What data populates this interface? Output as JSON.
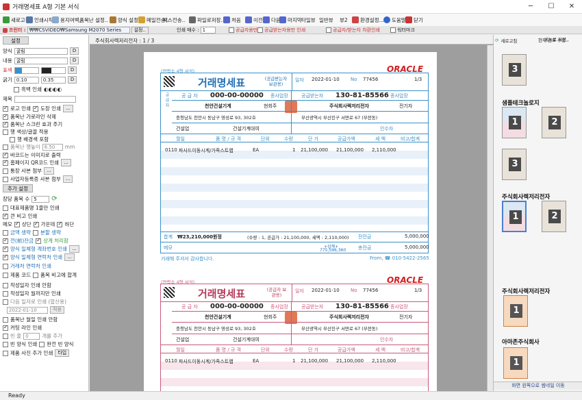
{
  "window": {
    "title": "거래명세표   A형 기본 서식"
  },
  "toolbar": {
    "items": [
      "새로고침",
      "인쇄시작",
      "용지여백,",
      "품목난 설정..",
      "양식 설정...",
      "메일전송..",
      "팩스전송..",
      "파일로저장..",
      "처음",
      "이전",
      "다음",
      "마지막",
      "타일뷰",
      "일반뷰",
      "뷰2",
      "환경설정...",
      "도움말",
      "닫기"
    ]
  },
  "toolbar2": {
    "printer_label": "프린터 :",
    "printer_value": "₩₩CSVIDEO₩Samsung M2070 Series",
    "printer_setup": "설정..",
    "copies_label": "인쇄 매수 :",
    "copies_value": "1",
    "opt1": "공급자용만",
    "opt2": "공급받는자용만 인쇄",
    "opt3": "공급자/받는자 차환인쇄",
    "opt4": "워터마크"
  },
  "left": {
    "tab": "설정",
    "font_label": "양식",
    "font_value": "굴림",
    "content_label": "내용",
    "content_value": "굴림",
    "color_label": "표색",
    "border_label": "굵기",
    "border_val1": "0.10",
    "border_val2": "0.35",
    "bw_print": "흑백 인쇄",
    "title_label": "제목",
    "logo_print": "로고 인쇄",
    "stamp_print": "도장 인쇄",
    "item_grid": "품목난 가로라인 삭제",
    "item_scroll": "품목난 스크린 효과 주기",
    "row_color": "행 색상/글꼴 적용",
    "row_bg": "행 배경색 포함",
    "item_height": "품목난 행높이",
    "item_height_val": "6.50",
    "item_height_unit": "mm",
    "barcode": "바코드는 이미지로 출력",
    "homepage_qr": "홈페이지 QR코드 인쇄",
    "bank_copy": "통장 사본 첨부",
    "biz_copy": "사업자등록증 사본 첨부",
    "tab2": "추가 설정",
    "item_count_label": "장당 품목 수",
    "item_count": "5",
    "max_items": "대표제품명 1줄만 인쇄",
    "big_note": "큰 비고 인쇄",
    "memo_label": "메모",
    "memo_top": "상단",
    "memo_mid": "가운데",
    "memo_bot": "하단",
    "sum_gen": "금액 생략",
    "split_gen": "분할 생략",
    "prev_balance": "전(前)잔금",
    "total_balance": "상계 처리함",
    "form_acct": "양식 일체형 계좌번호 인쇄",
    "form_contact": "양식 일체형 연락처 인쇄",
    "trade_contact": "거래처 연락처 인쇄",
    "product_code": "제품 코드",
    "item_note": "품목 비고에 합계",
    "write_date": "작성일자 인쇄 안함",
    "write_month": "작성일자 월까지만 인쇄",
    "next_date": "다음 일자로 인쇄 (합산용)",
    "date_value": "2022-01-10",
    "apply": "적용",
    "item_month": "품목난 월일 인쇄 안함",
    "cutline": "커팅 라인 인쇄",
    "blank_label": "빈 줄",
    "blank_val": "0",
    "blank_add": "개를 추가",
    "blank_form": "빈 양식 인쇄",
    "full_form": "완전 빈 양식",
    "product_photo": "제품 사진 추가 인쇄",
    "product_btn": "타입"
  },
  "center": {
    "header": "주식회사렉저리전자 : 1 / 3"
  },
  "invoice": {
    "small_title": "(연락소 4형 서식)",
    "title": "거래명세표",
    "role_top": "(공급받는자 보관용)",
    "role_bottom": "(공급자 보관용)",
    "date_label": "일자",
    "date": "2022-01-10",
    "no_label": "No",
    "no": "77456",
    "page": "1/3",
    "brand": "ORACLE",
    "supplier_label": "공 급 자",
    "supplier_reg": "000-00-00000",
    "buyer_label": "공급받는자",
    "buyer_reg": "130-81-85566",
    "biz_type": "종사업장",
    "supplier_name": "천안건설기계",
    "supplier_ceo": "현회주",
    "buyer_name": "주식회사렉저리전자",
    "buyer_ceo": "전기자",
    "supplier_addr": "충청남도 천안시 동남구 영성로 93, 302호",
    "buyer_addr": "부산광역시 부산진구 서면로 67 (부전동)",
    "supplier_biz": "건설업",
    "supplier_item": "건설기계대여",
    "buyer_person": "인수자",
    "cols": [
      "월일",
      "품 명 / 규 격",
      "단위",
      "수량",
      "단 가",
      "공급가액",
      "세 액",
      "비고/합계"
    ],
    "row": [
      "0110",
      "파사드이동시계/가족스트랩",
      "EA",
      "1",
      "21,100,000",
      "21,100,000",
      "2,110,000",
      ""
    ],
    "total_label": "합계",
    "total": "₩23,210,000원정",
    "total_detail": "(수량 : 1, 공급가 : 21,100,000, 세액 : 2,110,000)",
    "prev_label": "전잔금",
    "prev": "5,000,000",
    "memo_label": "메모",
    "sum_label": "총잔금",
    "sum": "5,000,000",
    "memo_val": "+상계+",
    "memo_val2": "775,596,360",
    "thanks": "거래해 주셔서 감사합니다.",
    "from": "From, ☎ 010-5422-2565"
  },
  "right": {
    "refresh": "새로고침",
    "current": "현재 견표 수정..",
    "menu": "메뉴로 저장..",
    "t1": "샘플테크놀로지",
    "t2": "주식회사렉저리전자",
    "t3": "주식회사렉저리전자",
    "t4": "아마존주식회사",
    "bottom": "화면 왼쪽으로 썸네일 이동",
    "n1": "3",
    "n2": "1",
    "n3": "2",
    "n4": "3",
    "n5": "1",
    "n6": "2",
    "n7": "1",
    "n8": "1"
  },
  "status": "Ready",
  "colors": {
    "cyan": "#3a90c8",
    "rose": "#c85a7a",
    "title_blue": "#1f6fb5",
    "title_red": "#b33a5a",
    "stamp": "#d9623a"
  }
}
